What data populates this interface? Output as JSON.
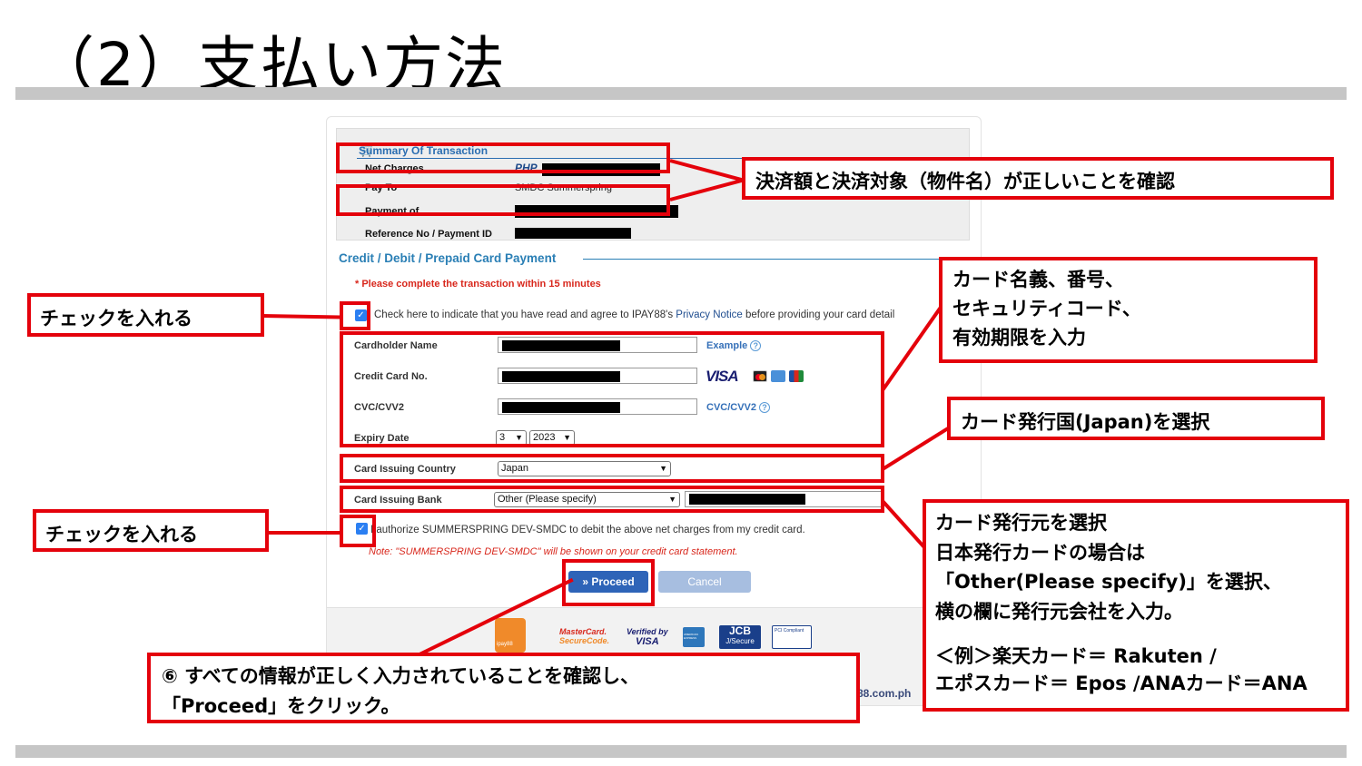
{
  "slide": {
    "title": "（2）支払い方法"
  },
  "summary": {
    "heading": "Summary Of Transaction",
    "net_charges_label": "Net Charges",
    "net_charges_currency": "PHP",
    "pay_to_label": "Pay To",
    "pay_to_value": "SMDC Summerspring",
    "payment_of_label": "Payment of",
    "reference_label": "Reference No / Payment ID"
  },
  "form": {
    "section_title": "Credit / Debit / Prepaid Card Payment",
    "warning": "* Please complete the transaction within 15 minutes",
    "agree_text": "Check here to indicate that you have read and agree to IPAY88's",
    "agree_link": "Privacy Notice",
    "agree_tail": "before providing your card detail",
    "cardholder_label": "Cardholder Name",
    "cardholder_link": "Example",
    "card_no_label": "Credit Card No.",
    "visa_text": "VISA",
    "cvc_label": "CVC/CVV2",
    "cvc_link": "CVC/CVV2",
    "expiry_label": "Expiry Date",
    "expiry_month": "3",
    "expiry_year": "2023",
    "country_label": "Card Issuing Country",
    "country_value": "Japan",
    "bank_label": "Card Issuing Bank",
    "bank_value": "Other (Please specify)",
    "authorize_text": "I authorize SUMMERSPRING DEV-SMDC to debit the above net charges from my credit card.",
    "note_text": "Note: \"SUMMERSPRING DEV-SMDC\" will be shown on your credit card statement.",
    "proceed_label": "» Proceed",
    "cancel_label": "Cancel",
    "footer_domain": "88.com.ph"
  },
  "logos": {
    "mastercard_line1": "MasterCard.",
    "mastercard_line2": "SecureCode.",
    "verified_line1": "Verified by",
    "verified_line2": "VISA",
    "jcb_line1": "JCB",
    "jcb_line2": "J/Secure",
    "amex": "AMERICAN EXPRESS",
    "pci": "PCI Compliant",
    "ipay": "ipay88"
  },
  "callouts": {
    "confirm_amount": "決済額と決済対象（物件名）が正しいことを確認",
    "check1": "チェックを入れる",
    "check2": "チェックを入れる",
    "card_info": [
      "カード名義、番号、",
      "セキュリティコード、",
      "有効期限を入力"
    ],
    "country": "カード発行国(Japan)を選択",
    "bank": [
      "カード発行元を選択",
      "日本発行カードの場合は",
      "「Other(Please specify)」を選択、",
      "横の欄に発行元会社を入力。",
      "",
      "＜例＞楽天カード＝ Rakuten /",
      "エポスカード＝ Epos /ANAカード＝ANA"
    ],
    "proceed": [
      "⑥ すべての情報が正しく入力されていることを確認し、",
      "「Proceed」をクリック。"
    ]
  },
  "colors": {
    "callout_red": "#e4010b",
    "rule_gray": "#c6c6c6",
    "link_blue": "#2a7fb5",
    "proceed_blue": "#2e64b8"
  }
}
